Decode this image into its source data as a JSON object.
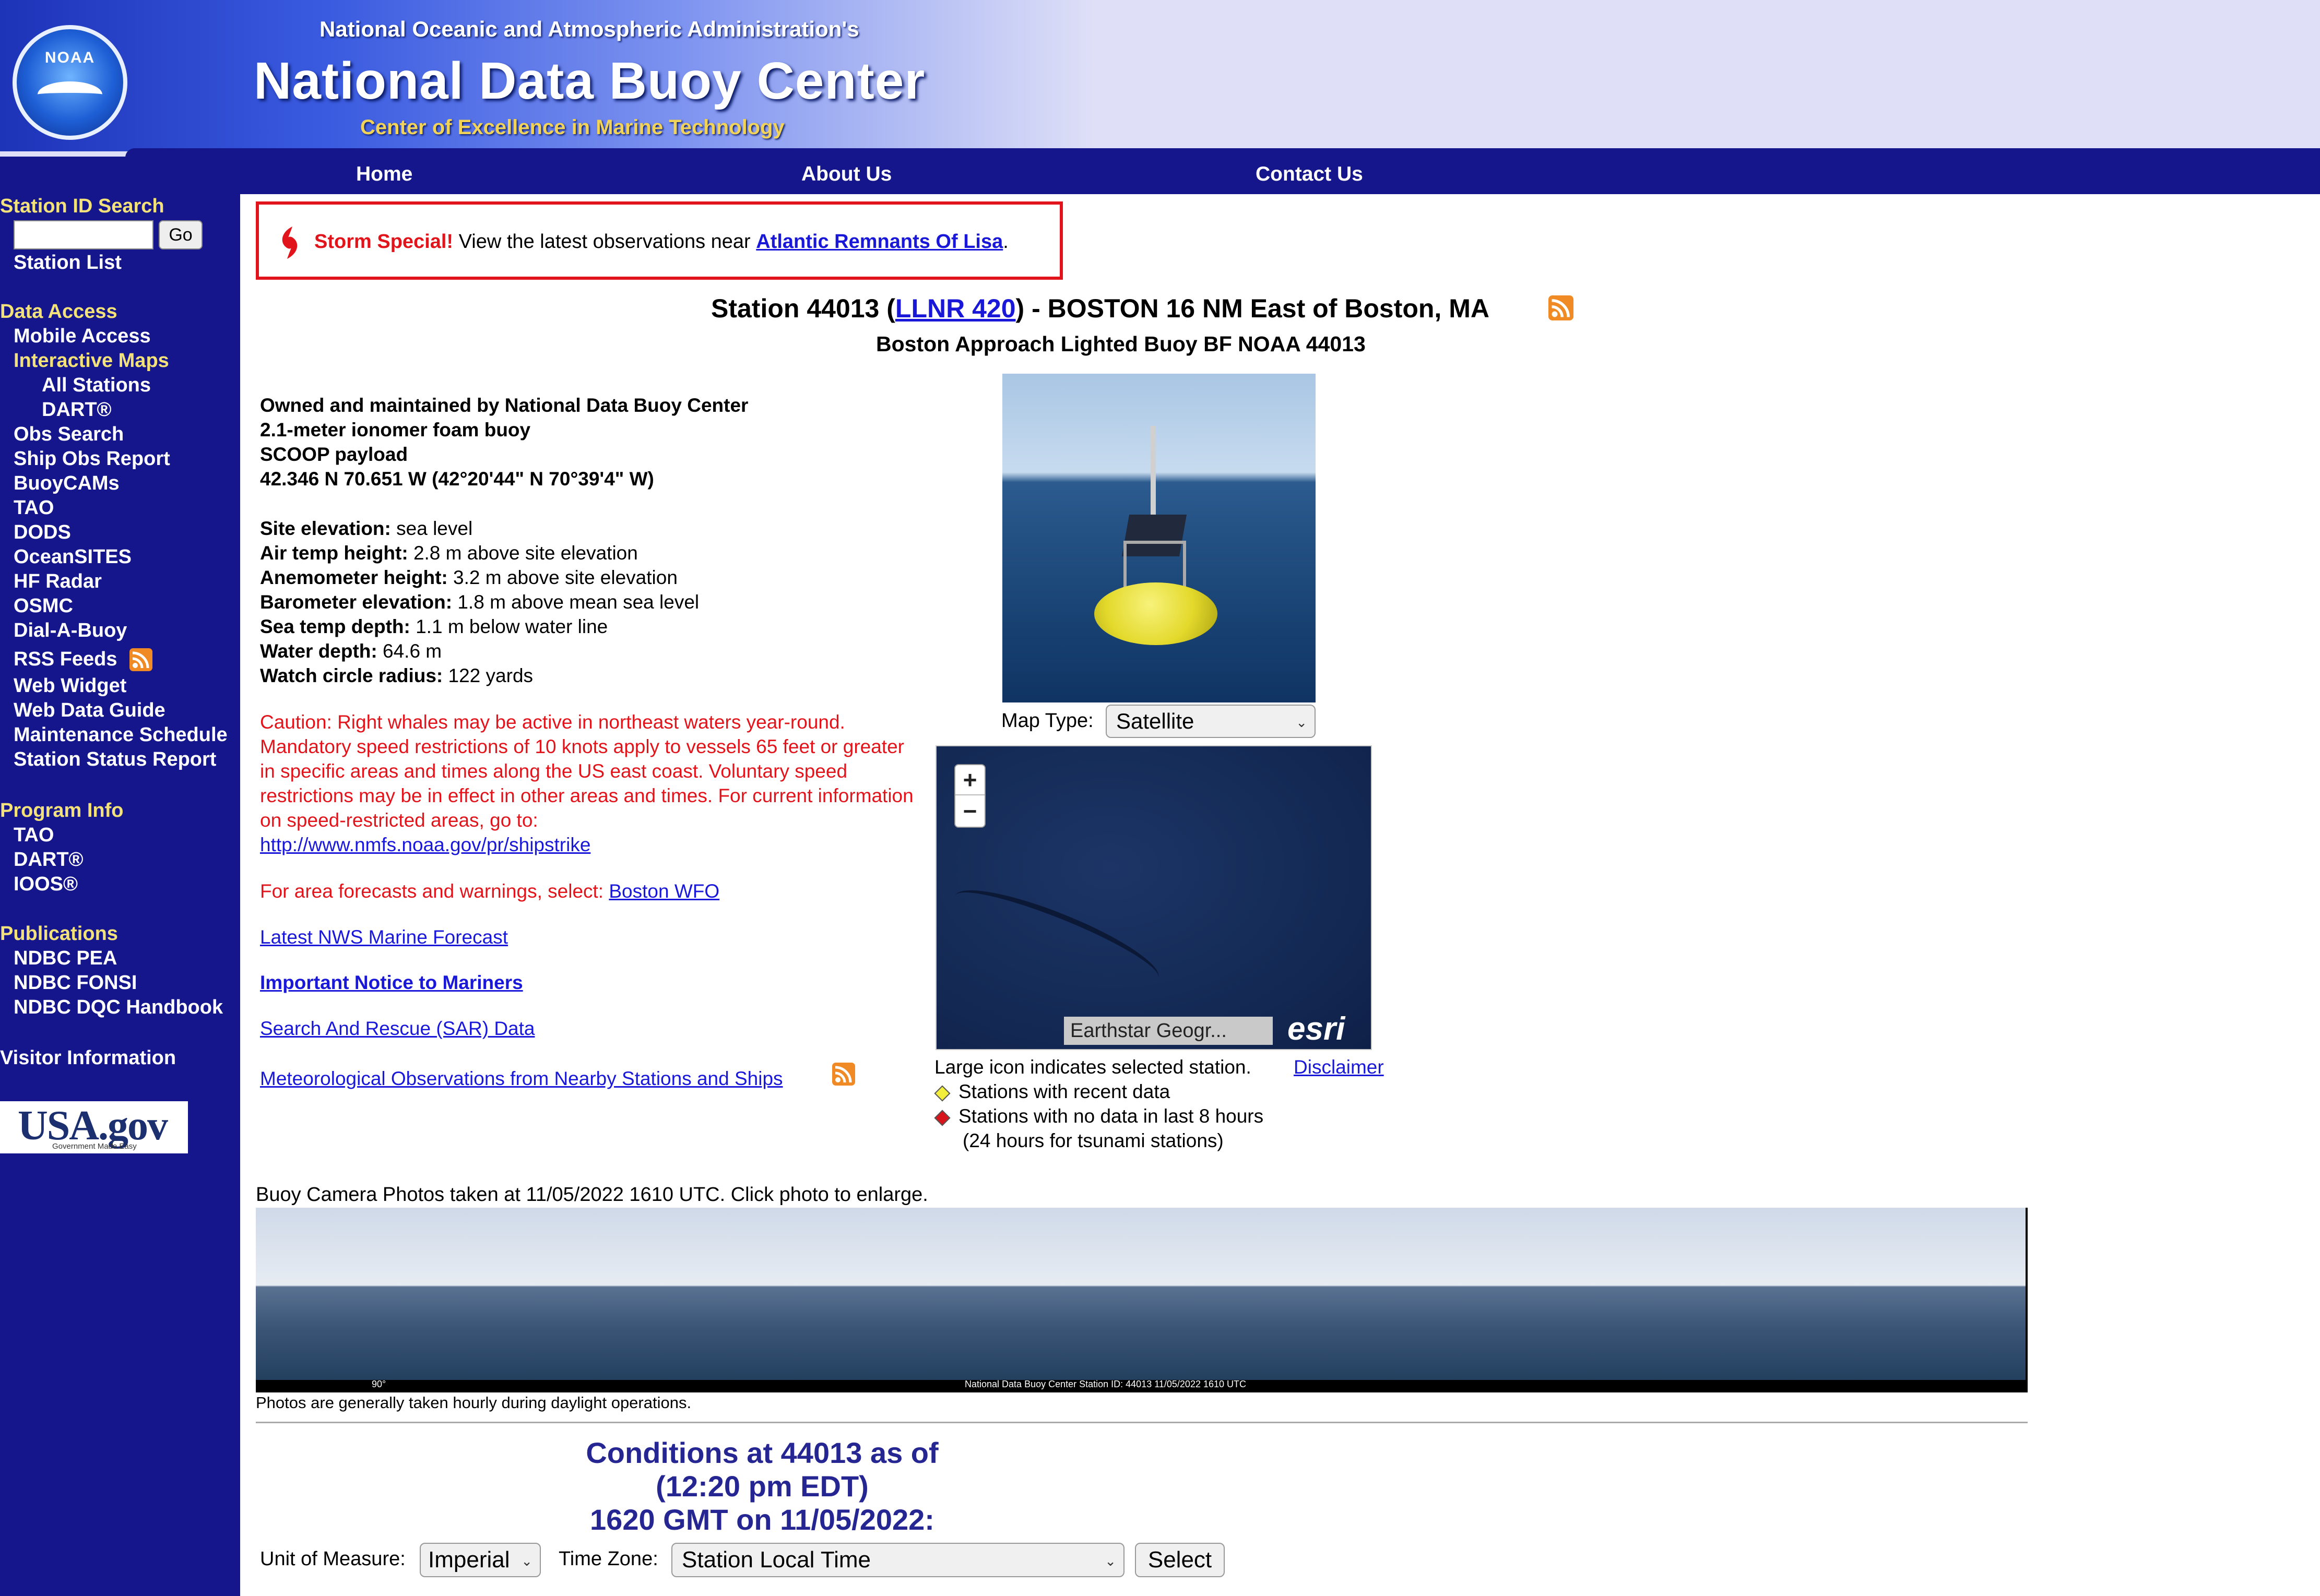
{
  "header": {
    "agency": "National Oceanic and Atmospheric Administration's",
    "title": "National Data Buoy Center",
    "tagline": "Center of Excellence in Marine Technology",
    "logo_text": "NOAA",
    "nav": [
      {
        "label": "Home"
      },
      {
        "label": "About Us"
      },
      {
        "label": "Contact Us"
      }
    ]
  },
  "sidebar": {
    "search_heading": "Station ID Search",
    "search_value": "",
    "go_label": "Go",
    "station_list": "Station List",
    "data_access_heading": "Data Access",
    "data_access_items": [
      "Mobile Access",
      "Interactive Maps",
      "All Stations",
      "DART®",
      "Obs Search",
      "Ship Obs Report",
      "BuoyCAMs",
      "TAO",
      "DODS",
      "OceanSITES",
      "HF Radar",
      "OSMC",
      "Dial-A-Buoy",
      "RSS Feeds",
      "Web Widget",
      "Web Data Guide",
      "Maintenance Schedule",
      "Station Status Report"
    ],
    "program_heading": "Program Info",
    "program_items": [
      "TAO",
      "DART®",
      "IOOS®"
    ],
    "publications_heading": "Publications",
    "publications_items": [
      "NDBC PEA",
      "NDBC FONSI",
      "NDBC DQC Handbook"
    ],
    "visitor_info": "Visitor Information",
    "usagov_logo": "USA.gov",
    "usagov_sub": "Government Made Easy"
  },
  "storm": {
    "label": "Storm Special!",
    "text": " View the latest observations near ",
    "link": "Atlantic Remnants Of Lisa",
    "end": "."
  },
  "station": {
    "title_prefix": "Station 44013 (",
    "title_link": "LLNR 420",
    "title_suffix": ") - BOSTON 16 NM East of Boston, MA",
    "subtitle": "Boston Approach Lighted Buoy BF NOAA 44013",
    "owner": "Owned and maintained by National Data Buoy Center",
    "hull": "2.1-meter ionomer foam buoy",
    "payload": "SCOOP payload",
    "location": "42.346 N 70.651 W (42°20'44\" N 70°39'4\" W)",
    "specs": [
      {
        "label": "Site elevation:",
        "value": " sea level"
      },
      {
        "label": "Air temp height:",
        "value": " 2.8 m above site elevation"
      },
      {
        "label": "Anemometer height:",
        "value": " 3.2 m above site elevation"
      },
      {
        "label": "Barometer elevation:",
        "value": " 1.8 m above mean sea level"
      },
      {
        "label": "Sea temp depth:",
        "value": " 1.1 m below water line"
      },
      {
        "label": "Water depth:",
        "value": " 64.6 m"
      },
      {
        "label": "Watch circle radius:",
        "value": " 122 yards"
      }
    ]
  },
  "caution": {
    "text": "Caution: Right whales may be active in northeast waters year-round. Mandatory speed restrictions of 10 knots apply to vessels 65 feet or greater in specific areas and times along the US east coast. Voluntary speed restrictions may be in effect in other areas and times. For current information on speed-restricted areas, go to:",
    "link": "http://www.nmfs.noaa.gov/pr/shipstrike"
  },
  "forecast": {
    "text": "For area forecasts and warnings, select: ",
    "link": "Boston WFO"
  },
  "links": {
    "marine_forecast": "Latest NWS Marine Forecast",
    "notice": "Important Notice to Mariners",
    "sar": "Search And Rescue (SAR) Data",
    "nearby": "Meteorological Observations from Nearby Stations and Ships"
  },
  "map": {
    "type_label": "Map Type:",
    "type_value": "Satellite",
    "zoom_in": "+",
    "zoom_out": "−",
    "attribution": "Earthstar Geogr...",
    "esri": "esri",
    "large_icon_text": "Large icon indicates selected station.",
    "disclaimer": "Disclaimer",
    "legend_recent": "Stations with recent data",
    "legend_nodata": "Stations with no data in last 8 hours",
    "legend_tsunami": "(24 hours for tsunami stations)",
    "recent_color": "#f2ee3a",
    "nodata_color": "#d8141b"
  },
  "camera": {
    "caption": "Buoy Camera Photos taken at 11/05/2022 1610 UTC. Click photo to enlarge.",
    "overlay_deg": "90°",
    "overlay": "National Data Buoy Center Station ID: 44013    11/05/2022 1610 UTC",
    "note": "Photos are generally taken hourly during daylight operations."
  },
  "conditions": {
    "line1": "Conditions at 44013 as of",
    "line2": "(12:20 pm EDT)",
    "line3": "1620 GMT on 11/05/2022:",
    "unit_label": "Unit of Measure:",
    "unit_value": "Imperial",
    "tz_label": "Time Zone:",
    "tz_value": "Station Local Time",
    "select_label": "Select"
  },
  "colors": {
    "nav_blue": "#15158c",
    "heading_yellow": "#f3e27a",
    "alert_red": "#e2141b",
    "link_blue": "#1a18d8",
    "conditions_blue": "#262693"
  }
}
